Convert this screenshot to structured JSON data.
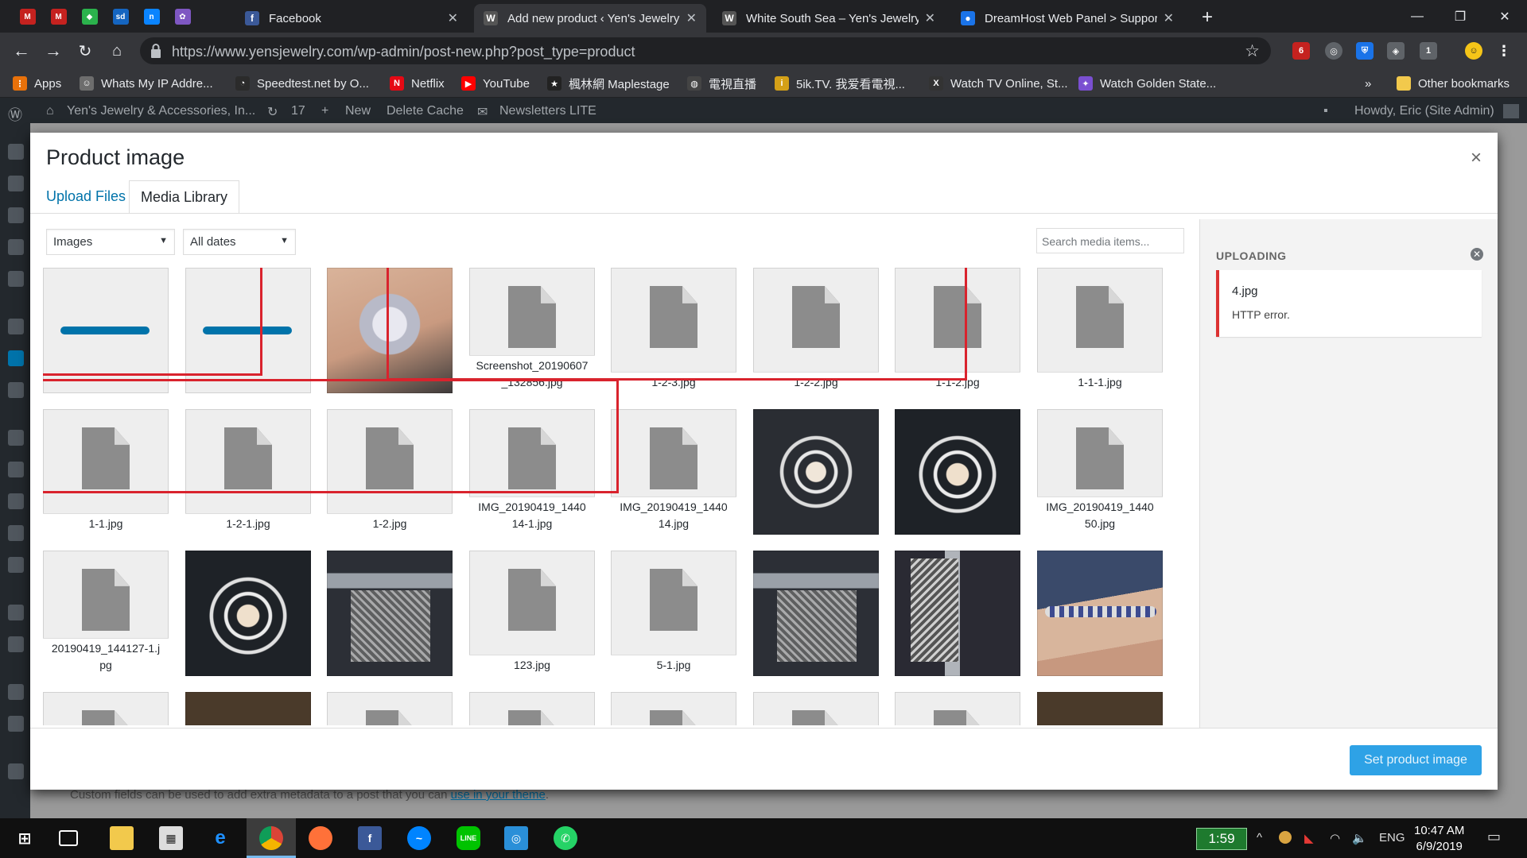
{
  "browser": {
    "tabs": [
      {
        "title": "Facebook",
        "favicon_color": "#3b5998",
        "glyph": "f",
        "active": false
      },
      {
        "title": "Add new product ‹ Yen's Jewelry",
        "favicon_color": "#555555",
        "glyph": "W",
        "active": true
      },
      {
        "title": "White South Sea – Yen's Jewelry",
        "favicon_color": "#555555",
        "glyph": "W",
        "active": false
      },
      {
        "title": "DreamHost Web Panel > Support",
        "favicon_color": "#1a73e8",
        "glyph": "●",
        "active": false
      }
    ],
    "pinned_tabs": [
      {
        "icon": "gmail-icon",
        "color": "#c5221f",
        "glyph": "M"
      },
      {
        "icon": "gmail-icon-2",
        "color": "#c5221f",
        "glyph": "M"
      },
      {
        "icon": "feedly-icon",
        "color": "#2bb24c",
        "glyph": "◆"
      },
      {
        "icon": "sd-icon",
        "color": "#1565c0",
        "glyph": "sd"
      },
      {
        "icon": "n-icon",
        "color": "#0a84ff",
        "glyph": "n"
      },
      {
        "icon": "app-icon",
        "color": "#7e57c2",
        "glyph": "✿"
      }
    ],
    "url": "https://www.yensjewelry.com/wp-admin/post-new.php?post_type=product",
    "bookmarks": [
      {
        "label": "Apps",
        "color": "#e8710a",
        "glyph": "⋮"
      },
      {
        "label": "Whats My IP Addre...",
        "color": "#6d6d6d",
        "glyph": "☺"
      },
      {
        "label": "Speedtest.net by O...",
        "color": "#2b2b2b",
        "glyph": "◔"
      },
      {
        "label": "Netflix",
        "color": "#e50914",
        "glyph": "N"
      },
      {
        "label": "YouTube",
        "color": "#ff0000",
        "glyph": "▶"
      },
      {
        "label": "楓林網 Maplestage",
        "color": "#222222",
        "glyph": "★"
      },
      {
        "label": "電視直播",
        "color": "#444444",
        "glyph": "◍"
      },
      {
        "label": "5ik.TV. 我爱看電視...",
        "color": "#d4a017",
        "glyph": "i"
      },
      {
        "label": "Watch TV Online, St...",
        "color": "#333333",
        "glyph": "X"
      },
      {
        "label": "Watch Golden State...",
        "color": "#7a4fd1",
        "glyph": "✦"
      }
    ],
    "other_bookmarks": "Other bookmarks",
    "ext_badges": [
      "6",
      "1"
    ]
  },
  "wp_admin_bar": {
    "site_name": "Yen's Jewelry & Accessories, In...",
    "updates_count": "17",
    "new_label": "New",
    "delete_cache": "Delete Cache",
    "newsletters": "Newsletters LITE",
    "howdy": "Howdy, Eric (Site Admin)"
  },
  "modal": {
    "title": "Product image",
    "close": "×",
    "tabs": {
      "upload": "Upload Files",
      "library": "Media Library"
    },
    "filters": {
      "type": "Images",
      "dates": "All dates",
      "search_placeholder": "Search media items..."
    },
    "attachments": [
      {
        "type": "uploading"
      },
      {
        "type": "uploading"
      },
      {
        "type": "photo",
        "style": "photo-ring"
      },
      {
        "type": "doc",
        "name": "Screenshot_20190607_132856.jpg"
      },
      {
        "type": "doc",
        "name": "1-2-3.jpg"
      },
      {
        "type": "doc",
        "name": "1-2-2.jpg"
      },
      {
        "type": "doc",
        "name": "1-1-2.jpg"
      },
      {
        "type": "doc",
        "name": "1-1-1.jpg"
      },
      {
        "type": "doc",
        "name": "1-1.jpg"
      },
      {
        "type": "doc",
        "name": "1-2-1.jpg"
      },
      {
        "type": "doc",
        "name": "1-2.jpg"
      },
      {
        "type": "doc",
        "name": "IMG_20190419_144014-1.jpg"
      },
      {
        "type": "doc",
        "name": "IMG_20190419_144014.jpg"
      },
      {
        "type": "photo",
        "style": "photo-flower"
      },
      {
        "type": "photo",
        "style": "photo-flower2"
      },
      {
        "type": "doc",
        "name": "IMG_20190419_144050.jpg"
      },
      {
        "type": "doc",
        "name": "20190419_144127-1.jpg"
      },
      {
        "type": "photo",
        "style": "photo-flower2"
      },
      {
        "type": "photo",
        "style": "photo-caliper"
      },
      {
        "type": "doc",
        "name": "123.jpg"
      },
      {
        "type": "doc",
        "name": "5-1.jpg"
      },
      {
        "type": "photo",
        "style": "photo-caliper"
      },
      {
        "type": "photo",
        "style": "photo-caliper2"
      },
      {
        "type": "photo",
        "style": "photo-bracelet"
      },
      {
        "type": "doc",
        "name": ""
      },
      {
        "type": "photo",
        "style": "photo-dark"
      },
      {
        "type": "doc",
        "name": ""
      },
      {
        "type": "doc",
        "name": ""
      },
      {
        "type": "doc",
        "name": ""
      },
      {
        "type": "doc",
        "name": ""
      },
      {
        "type": "doc",
        "name": ""
      },
      {
        "type": "photo",
        "style": "photo-dark"
      }
    ],
    "uploading": {
      "heading": "UPLOADING",
      "file": "4.jpg",
      "error": "HTTP error."
    },
    "set_button": "Set product image"
  },
  "background_text": {
    "prefix": "Custom fields can be used to add extra metadata to a post that you can ",
    "link": "use in your theme",
    "suffix": "."
  },
  "taskbar": {
    "timer": "1:59",
    "language": "ENG",
    "time": "10:47 AM",
    "date": "6/9/2019"
  }
}
